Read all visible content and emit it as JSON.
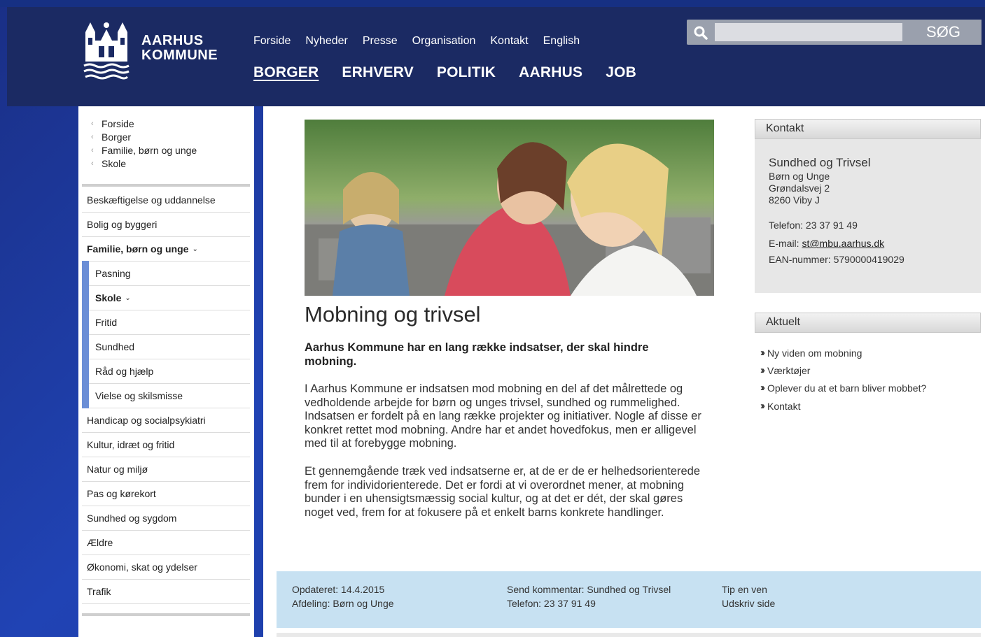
{
  "header": {
    "logo_line1": "AARHUS",
    "logo_line2": "KOMMUNE",
    "top_links": [
      "Forside",
      "Nyheder",
      "Presse",
      "Organisation",
      "Kontakt",
      "English"
    ],
    "main_links": [
      "BORGER",
      "ERHVERV",
      "POLITIK",
      "AARHUS",
      "JOB"
    ],
    "search_placeholder": "",
    "search_button": "SØG"
  },
  "breadcrumb": [
    "Forside",
    "Borger",
    "Familie, børn og unge",
    "Skole"
  ],
  "sidebar": {
    "items": [
      {
        "label": "Beskæftigelse og uddannelse"
      },
      {
        "label": "Bolig og byggeri"
      },
      {
        "label": "Familie, børn og unge"
      },
      {
        "label": "Pasning"
      },
      {
        "label": "Skole"
      },
      {
        "label": "Fritid"
      },
      {
        "label": "Sundhed"
      },
      {
        "label": "Råd og hjælp"
      },
      {
        "label": "Vielse og skilsmisse"
      },
      {
        "label": "Handicap og socialpsykiatri"
      },
      {
        "label": "Kultur, idræt og fritid"
      },
      {
        "label": "Natur og miljø"
      },
      {
        "label": "Pas og kørekort"
      },
      {
        "label": "Sundhed og sygdom"
      },
      {
        "label": "Ældre"
      },
      {
        "label": "Økonomi, skat og ydelser"
      },
      {
        "label": "Trafik"
      }
    ],
    "expand_glyph": "⌄"
  },
  "article": {
    "title": "Mobning og trivsel",
    "lead": "Aarhus Kommune har en lang række indsatser, der skal hindre mobning.",
    "p1": "I Aarhus Kommune er indsatsen mod mobning en del af det målrettede og vedholdende arbejde for børn og unges trivsel, sundhed og rummelighed. Indsatsen er fordelt på en lang række projekter og initiativer. Nogle af disse er konkret rettet mod mobning. Andre har et andet hovedfokus, men er alligevel med til at forebygge mobning.",
    "p2": "Et gennemgående træk ved indsatserne er, at de er de er helhedsorienterede frem for individorienterede. Det er fordi at vi overordnet mener, at mobning bunder i en uhensigtsmæssig social kultur, og at det er dét, der skal gøres noget ved, frem for at fokusere på et enkelt barns konkrete handlinger."
  },
  "kontakt": {
    "heading": "Kontakt",
    "org": "Sundhed og Trivsel",
    "dept": "Børn og Unge",
    "street": "Grøndalsvej 2",
    "city": "8260 Viby J",
    "phone": "Telefon: 23 37 91 49",
    "email_label": "E-mail: ",
    "email": "st@mbu.aarhus.dk",
    "ean": "EAN-nummer: 5790000419029"
  },
  "aktuelt": {
    "heading": "Aktuelt",
    "links": [
      "Ny viden om mobning",
      "Værktøjer",
      "Oplever du at et barn bliver mobbet?",
      "Kontakt"
    ]
  },
  "footer": {
    "updated": "Opdateret: 14.4.2015",
    "dept": "Afdeling: Børn og Unge",
    "comment": "Send kommentar: Sundhed og Trivsel",
    "phone": "Telefon: 23 37 91 49",
    "tip": "Tip en ven",
    "print": "Udskriv side"
  },
  "colors": {
    "page_bg": "#1c3a9e",
    "header_bg": "#1b2a63",
    "submenu_accent": "#6b8ed6",
    "footer_bg": "#c7e1f2"
  }
}
